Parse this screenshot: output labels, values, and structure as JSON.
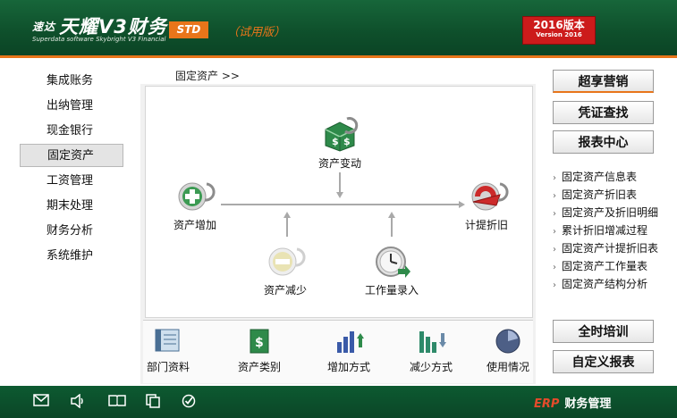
{
  "header": {
    "logo_prefix": "速达",
    "logo_text": "天耀V3财务",
    "logo_subtitle": "Superdata software Skybright V3 Financial",
    "edition": "STD",
    "trial_label": "（试用版）",
    "version_main": "2016版本",
    "version_sub": "Version 2016"
  },
  "nav": {
    "items": [
      "集成账务",
      "出纳管理",
      "现金银行",
      "固定资产",
      "工资管理",
      "期末处理",
      "财务分析",
      "系统维护"
    ],
    "active_index": 3
  },
  "breadcrumb": "固定资产  >>",
  "flow": {
    "change": "资产变动",
    "add": "资产增加",
    "depreciation": "计提折旧",
    "reduce": "资产减少",
    "workload": "工作量录入"
  },
  "toolbar": {
    "items": [
      "部门资料",
      "资产类别",
      "增加方式",
      "减少方式",
      "使用情况"
    ]
  },
  "right": {
    "marketing": "超享营销",
    "voucher": "凭证查找",
    "report_center": "报表中心",
    "links": [
      "固定资产信息表",
      "固定资产折旧表",
      "固定资产及折旧明细",
      "累计折旧增减过程",
      "固定资产计提折旧表",
      "固定资产工作量表",
      "固定资产结构分析"
    ],
    "training": "全时培训",
    "custom_report": "自定义报表"
  },
  "footer": {
    "erp_tag": "ERP",
    "erp_text": "财务管理",
    "icons": [
      "mail-icon",
      "volume-icon",
      "book-icon",
      "copy-icon",
      "check-icon"
    ]
  },
  "colors": {
    "brand_green": "#0e4f2b",
    "accent_orange": "#e8751a",
    "version_red": "#cc1b1b"
  }
}
